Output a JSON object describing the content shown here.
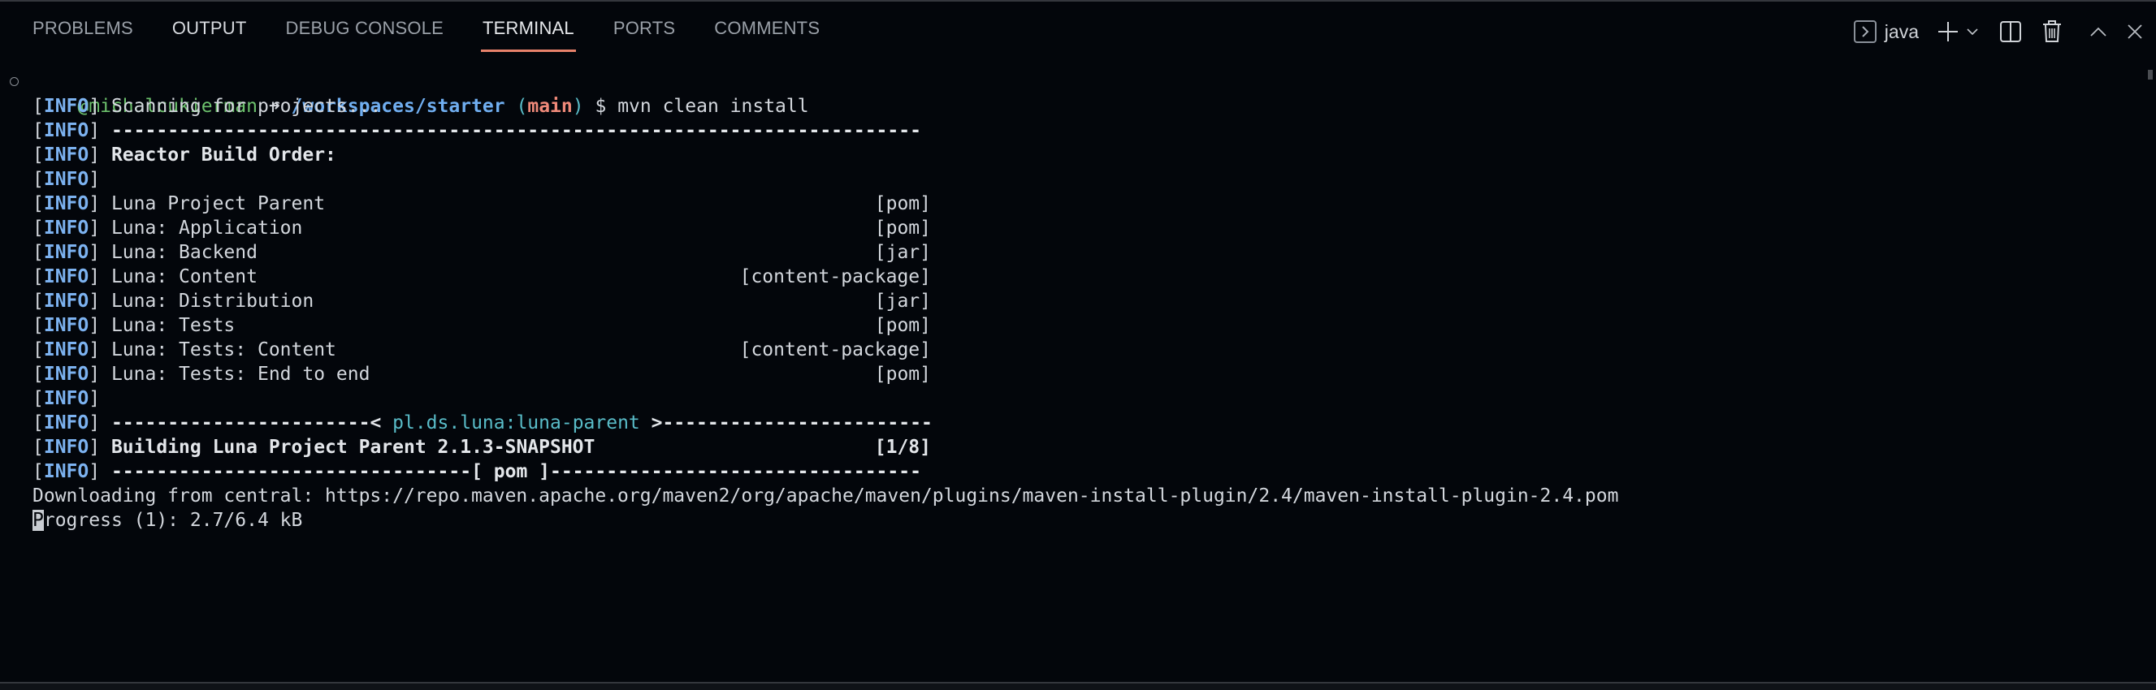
{
  "panel": {
    "tabs": [
      {
        "label": "PROBLEMS",
        "active": false
      },
      {
        "label": "OUTPUT",
        "active": false
      },
      {
        "label": "DEBUG CONSOLE",
        "active": false
      },
      {
        "label": "TERMINAL",
        "active": true
      },
      {
        "label": "PORTS",
        "active": false
      },
      {
        "label": "COMMENTS",
        "active": false
      }
    ],
    "actions": {
      "terminal_icon": "terminal-icon",
      "terminal_name": "java",
      "new_terminal_icon": "plus-icon",
      "launch_profile_icon": "chevron-down-icon",
      "split_icon": "split-icon",
      "kill_icon": "trash-icon",
      "maximize_icon": "chevron-up-icon",
      "close_icon": "close-icon"
    },
    "accent_color": "#e8826b"
  },
  "terminal": {
    "prompt": {
      "user": "@michalcukierman",
      "arrow": "➜",
      "path": "/workspaces/starter",
      "branch_open": "(",
      "branch": "main",
      "branch_close": ")",
      "dollar": "$",
      "command": "mvn clean install"
    },
    "info_tag": "INFO",
    "lines": {
      "scanning": "Scanning for projects...",
      "separator": "------------------------------------------------------------------------",
      "reactor": "Reactor Build Order:",
      "modules": [
        {
          "name": "Luna Project Parent",
          "packaging": "[pom]"
        },
        {
          "name": "Luna: Application",
          "packaging": "[pom]"
        },
        {
          "name": "Luna: Backend",
          "packaging": "[jar]"
        },
        {
          "name": "Luna: Content",
          "packaging": "[content-package]"
        },
        {
          "name": "Luna: Distribution",
          "packaging": "[jar]"
        },
        {
          "name": "Luna: Tests",
          "packaging": "[pom]"
        },
        {
          "name": "Luna: Tests: Content",
          "packaging": "[content-package]"
        },
        {
          "name": "Luna: Tests: End to end",
          "packaging": "[pom]"
        }
      ],
      "artifact_left": "-----------------------< ",
      "artifact": "pl.ds.luna:luna-parent",
      "artifact_right": " >------------------------",
      "building": "Building Luna Project Parent 2.1.3-SNAPSHOT",
      "building_counter": "[1/8]",
      "pom_sep": "--------------------------------[ pom ]---------------------------------",
      "downloading": "Downloading from central: https://repo.maven.apache.org/maven2/org/apache/maven/plugins/maven-install-plugin/2.4/maven-install-plugin-2.4.pom",
      "progress_first": "P",
      "progress_rest": "rogress (1): 2.7/6.4 kB"
    }
  }
}
